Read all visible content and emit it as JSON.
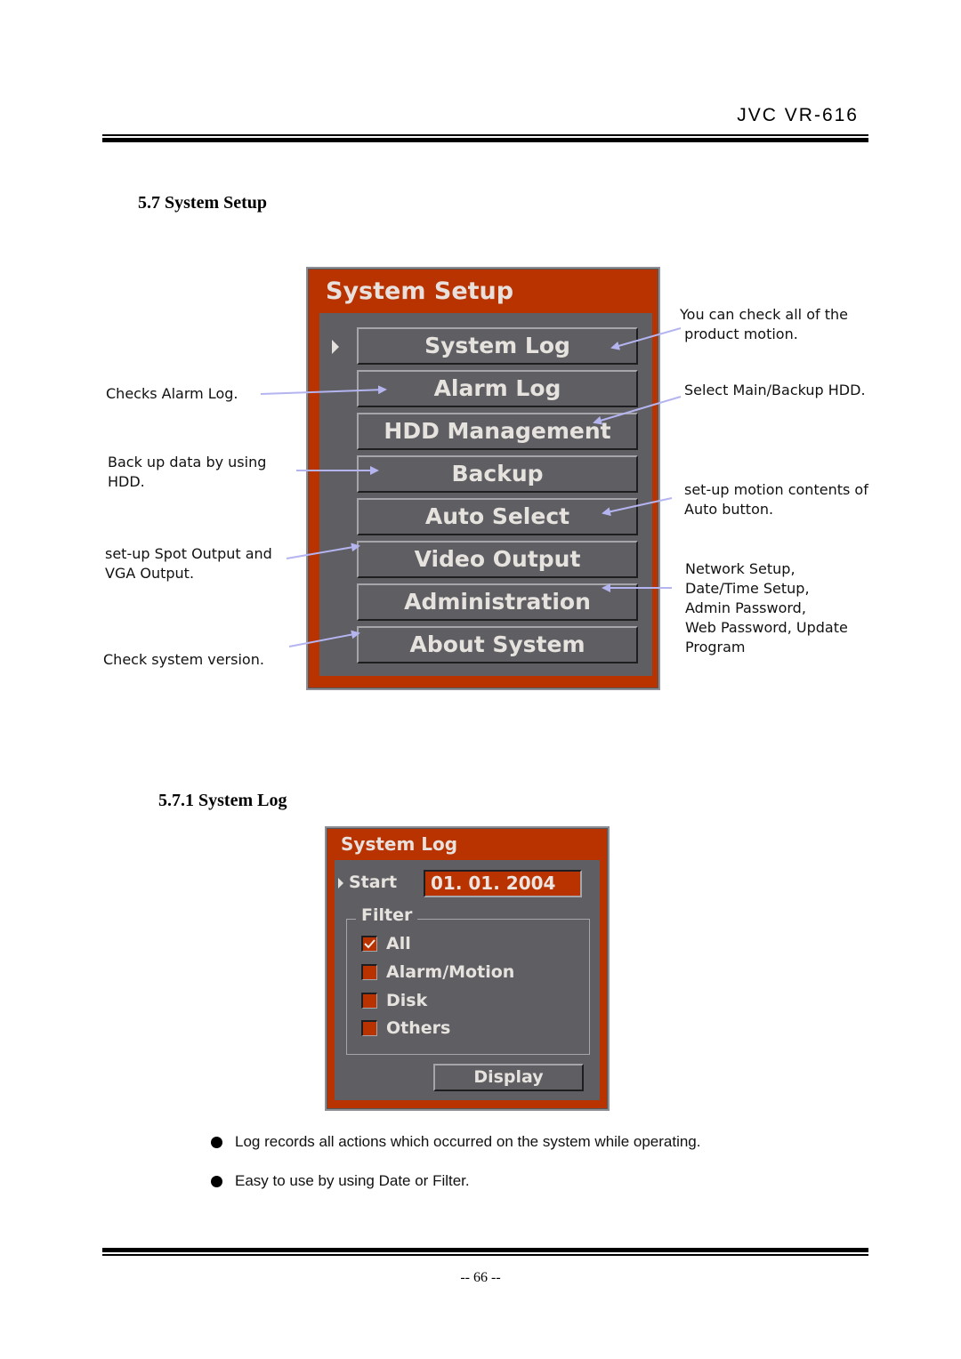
{
  "header": {
    "brand": "JVC VR-616"
  },
  "section": {
    "title": "5.7 System Setup"
  },
  "system_setup_panel": {
    "title": "System Setup",
    "selected_index": 0,
    "items": [
      {
        "label": "System Log"
      },
      {
        "label": "Alarm Log"
      },
      {
        "label": "HDD Management"
      },
      {
        "label": "Backup"
      },
      {
        "label": "Auto Select"
      },
      {
        "label": "Video Output"
      },
      {
        "label": "Administration"
      },
      {
        "label": "About System"
      }
    ],
    "colors": {
      "frame": "#b83300",
      "inner": "#5f5e63",
      "text": "#e6e2de",
      "annotation_arrow": "#b4b4f0"
    }
  },
  "annotations": {
    "left": [
      {
        "text": "Checks Alarm Log.",
        "target": "Alarm Log"
      },
      {
        "text": "Back up data by using\nHDD.",
        "target": "Backup"
      },
      {
        "text": "set-up Spot Output and\nVGA Output.",
        "target": "Video Output"
      },
      {
        "text": "Check system version.",
        "target": "About System"
      }
    ],
    "right": [
      {
        "text": "You can check all of the\n product motion.",
        "target": "System Log"
      },
      {
        "text": "Select Main/Backup HDD.",
        "target": "HDD Management"
      },
      {
        "text": "set-up motion contents of\nAuto button.",
        "target": "Auto Select"
      },
      {
        "text": "Network Setup,\nDate/Time Setup,\nAdmin Password,\nWeb Password, Update\nProgram",
        "target": "Administration"
      }
    ]
  },
  "subsection": {
    "title": "5.7.1  System Log"
  },
  "system_log_panel": {
    "title": "System Log",
    "start_label": "Start",
    "start_value": "01. 01. 2004",
    "filter_label": "Filter",
    "filters": [
      {
        "label": "All",
        "checked": true
      },
      {
        "label": "Alarm/Motion",
        "checked": false
      },
      {
        "label": "Disk",
        "checked": false
      },
      {
        "label": "Others",
        "checked": false
      }
    ],
    "display_button": "Display"
  },
  "bullets": [
    "Log records all actions which occurred on the system while operating.",
    "Easy to use by using Date or Filter."
  ],
  "footer": {
    "page": "-- 66 --"
  }
}
